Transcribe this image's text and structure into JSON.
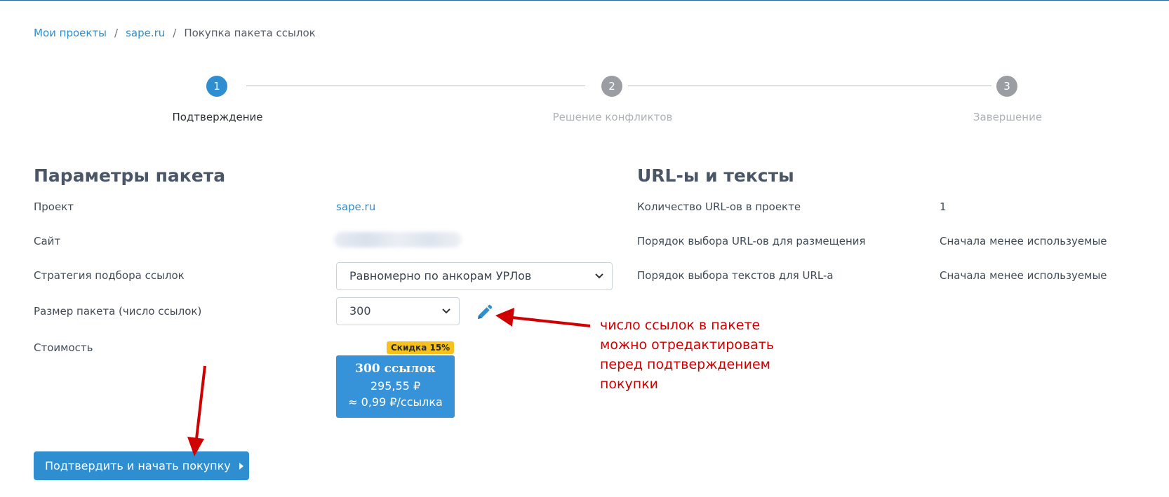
{
  "breadcrumb": {
    "items": [
      "Мои проекты",
      "sape.ru"
    ],
    "separator": "/",
    "current": "Покупка пакета ссылок"
  },
  "stepper": {
    "steps": [
      {
        "number": "1",
        "label": "Подтверждение",
        "state": "active"
      },
      {
        "number": "2",
        "label": "Решение конфликтов",
        "state": "inactive"
      },
      {
        "number": "3",
        "label": "Завершение",
        "state": "inactive"
      }
    ]
  },
  "params": {
    "title": "Параметры пакета",
    "project_label": "Проект",
    "project_value": "sape.ru",
    "site_label": "Сайт",
    "strategy_label": "Стратегия подбора ссылок",
    "strategy_value": "Равномерно по анкорам УРЛов",
    "size_label": "Размер пакета (число ссылок)",
    "size_value": "300",
    "cost_label": "Стоимость"
  },
  "price_card": {
    "discount": "Скидка 15%",
    "title": "300 ссылок",
    "price": "295,55 ₽",
    "per_link": "≈ 0,99 ₽/ссылка"
  },
  "urls": {
    "title": "URL-ы и тексты",
    "rows": [
      {
        "label": "Количество URL-ов в проекте",
        "value": "1"
      },
      {
        "label": "Порядок выбора URL-ов для размещения",
        "value": "Сначала менее используемые"
      },
      {
        "label": "Порядок выбора текстов для URL-а",
        "value": "Сначала менее используемые"
      }
    ]
  },
  "confirm_button": "Подтвердить и начать покупку",
  "annotation": {
    "lines": [
      "число ссылок в пакете",
      "можно отредактировать",
      "перед подтверждением",
      "покупки"
    ]
  },
  "colors": {
    "accent": "#2f8ed0",
    "badge": "#f6c11a",
    "annotation": "#d00000",
    "inactive_step": "#9a9da1"
  },
  "icons": {
    "edit": "pencil-icon",
    "select": "chevron-down-icon",
    "button": "caret-right-icon"
  }
}
